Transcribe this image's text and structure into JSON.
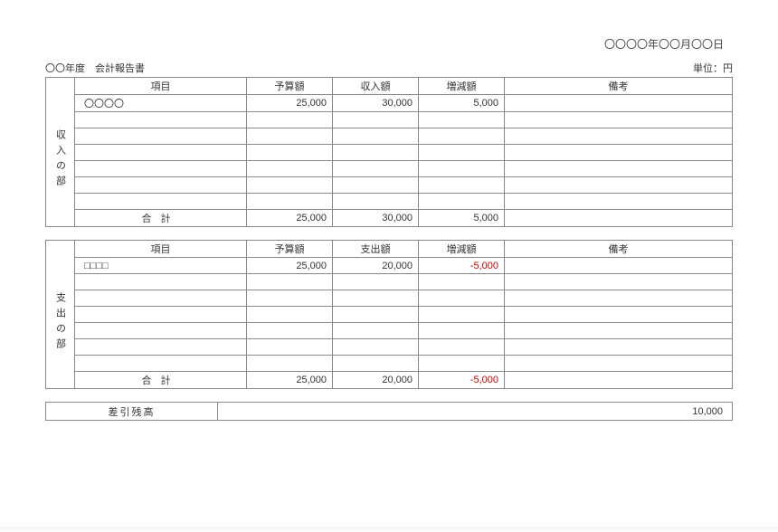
{
  "date_line": "〇〇〇〇年〇〇月〇〇日",
  "title": "〇〇年度　会計報告書",
  "unit_label": "単位：円",
  "income": {
    "side_label": "収入の部",
    "headers": {
      "item": "項目",
      "budget": "予算額",
      "actual": "収入額",
      "diff": "増減額",
      "note": "備考"
    },
    "rows": [
      {
        "item": "〇〇〇〇",
        "budget": "25,000",
        "actual": "30,000",
        "diff": "5,000",
        "note": ""
      },
      {
        "item": "",
        "budget": "",
        "actual": "",
        "diff": "",
        "note": ""
      },
      {
        "item": "",
        "budget": "",
        "actual": "",
        "diff": "",
        "note": ""
      },
      {
        "item": "",
        "budget": "",
        "actual": "",
        "diff": "",
        "note": ""
      },
      {
        "item": "",
        "budget": "",
        "actual": "",
        "diff": "",
        "note": ""
      },
      {
        "item": "",
        "budget": "",
        "actual": "",
        "diff": "",
        "note": ""
      },
      {
        "item": "",
        "budget": "",
        "actual": "",
        "diff": "",
        "note": ""
      }
    ],
    "total_label": "合計",
    "total": {
      "budget": "25,000",
      "actual": "30,000",
      "diff": "5,000",
      "note": ""
    }
  },
  "expense": {
    "side_label": "支出の部",
    "headers": {
      "item": "項目",
      "budget": "予算額",
      "actual": "支出額",
      "diff": "増減額",
      "note": "備考"
    },
    "rows": [
      {
        "item": "□□□□",
        "budget": "25,000",
        "actual": "20,000",
        "diff": "-5,000",
        "diff_neg": true,
        "note": ""
      },
      {
        "item": "",
        "budget": "",
        "actual": "",
        "diff": "",
        "note": ""
      },
      {
        "item": "",
        "budget": "",
        "actual": "",
        "diff": "",
        "note": ""
      },
      {
        "item": "",
        "budget": "",
        "actual": "",
        "diff": "",
        "note": ""
      },
      {
        "item": "",
        "budget": "",
        "actual": "",
        "diff": "",
        "note": ""
      },
      {
        "item": "",
        "budget": "",
        "actual": "",
        "diff": "",
        "note": ""
      },
      {
        "item": "",
        "budget": "",
        "actual": "",
        "diff": "",
        "note": ""
      }
    ],
    "total_label": "合計",
    "total": {
      "budget": "25,000",
      "actual": "20,000",
      "diff": "-5,000",
      "diff_neg": true,
      "note": ""
    }
  },
  "balance": {
    "label": "差引残高",
    "amount": "10,000"
  }
}
